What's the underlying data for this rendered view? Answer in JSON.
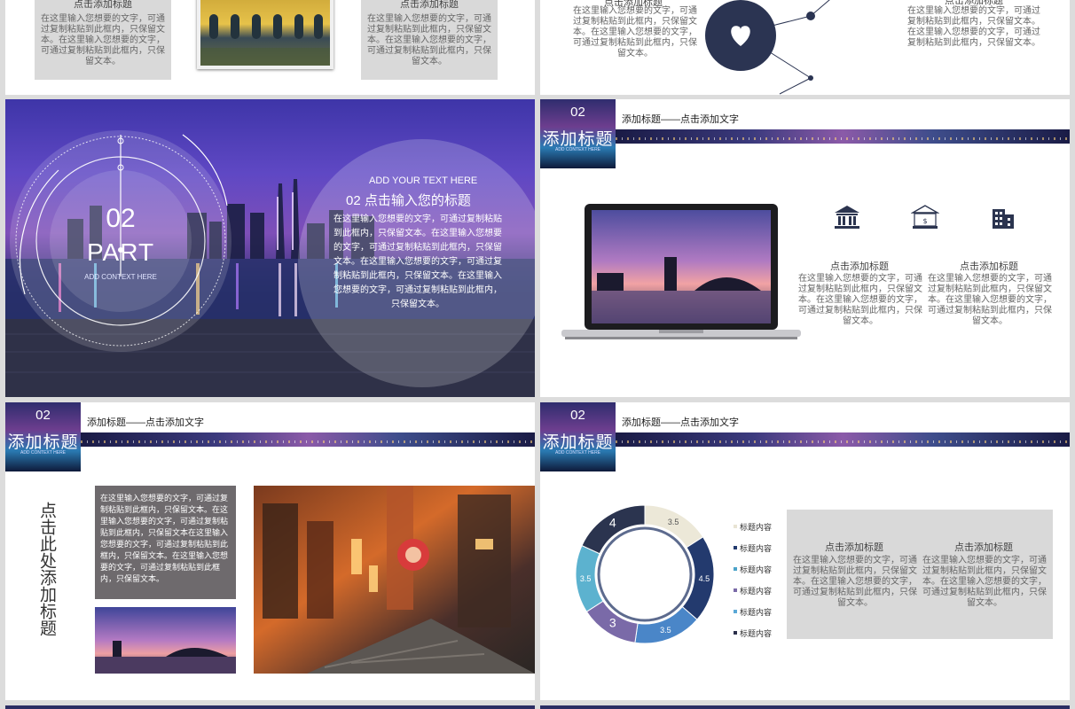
{
  "slide1": {
    "left_title": "点击添加标题",
    "right_title": "点击添加标题",
    "left_text": "在这里输入您想要的文字，可通过复制粘贴到此框内，只保留文本。在这里输入您想要的文字，可通过复制粘贴到此框内，只保留文本。",
    "right_text": "在这里输入您想要的文字，可通过复制粘贴到此框内，只保留文本。在这里输入您想要的文字，可通过复制粘贴到此框内，只保留文本。"
  },
  "slide2": {
    "left_title": "点击添加标题",
    "right_title": "点击添加标题",
    "left_text": "在这里输入您想要的文字，可通过复制粘贴到此框内，只保留文本。在这里输入您想要的文字，可通过复制粘贴到此框内，只保留文本。",
    "right_text": "在这里输入您想要的文字，可通过复制粘贴到此框内，只保留文本。在这里输入您想要的文字，可通过复制粘贴到此框内，只保留文本。"
  },
  "slide3": {
    "number": "02",
    "part": "PART",
    "subtitle": "ADD CONTEXT HERE",
    "en_heading": "ADD YOUR TEXT HERE",
    "heading": "02  点击输入您的标题",
    "body": "在这里输入您想要的文字，可通过复制粘贴到此框内，只保留文本。在这里输入您想要的文字，可通过复制粘贴到此框内，只保留文本。在这里输入您想要的文字，可通过复制粘贴到此框内，只保留文本。在这里输入您想要的文字，可通过复制粘贴到此框内，只保留文本。"
  },
  "header": {
    "num": "02",
    "big": "添加标题",
    "en": "ADD CONTEXT HERE",
    "title": "添加标题——点击添加文字"
  },
  "slide4": {
    "left_title": "点击添加标题",
    "right_title": "点击添加标题",
    "left_text": "在这里输入您想要的文字，可通过复制粘贴到此框内，只保留文本。在这里输入您想要的文字，可通过复制粘贴到此框内，只保留文本。",
    "right_text": "在这里输入您想要的文字，可通过复制粘贴到此框内，只保留文本。在这里输入您想要的文字，可通过复制粘贴到此框内，只保留文本。"
  },
  "slide5": {
    "vertical_title": "点击此处添加标题",
    "box_text": "在这里输入您想要的文字，可通过复制粘贴到此框内，只保留文本。在这里输入您想要的文字，可通过复制粘贴到此框内，只保留文本在这里输入您想要的文字，可通过复制粘贴到此框内，只保留文本。在这里输入您想要的文字，可通过复制粘贴到此框内，只保留文本。"
  },
  "slide6": {
    "box_left_title": "点击添加标题",
    "box_right_title": "点击添加标题",
    "box_left_text": "在这里输入您想要的文字，可通过复制粘贴到此框内，只保留文本。在这里输入您想要的文字，可通过复制粘贴到此框内，只保留文本。",
    "box_right_text": "在这里输入您想要的文字，可通过复制粘贴到此框内，只保留文本。在这里输入您想要的文字，可通过复制粘贴到此框内，只保留文本。",
    "legend": [
      "标题内容",
      "标题内容",
      "标题内容",
      "标题内容",
      "标题内容",
      "标题内容"
    ],
    "legend_colors": [
      "#e8e4d4",
      "#233a6e",
      "#4ba3c9",
      "#7a6aa8",
      "#5aa8d6",
      "#2b2f4a"
    ]
  },
  "chart_data": {
    "type": "pie",
    "categories": [
      "",
      "",
      "",
      "",
      "",
      ""
    ],
    "values": [
      3.5,
      4.5,
      3.5,
      3,
      3.5,
      4
    ],
    "colors": [
      "#ece8d8",
      "#233a6e",
      "#4a86c8",
      "#7a6aa8",
      "#5cb2cf",
      "#2b344f"
    ],
    "labels": [
      "3.5",
      "4.5",
      "3.5",
      "3",
      "3.5",
      "4"
    ]
  }
}
